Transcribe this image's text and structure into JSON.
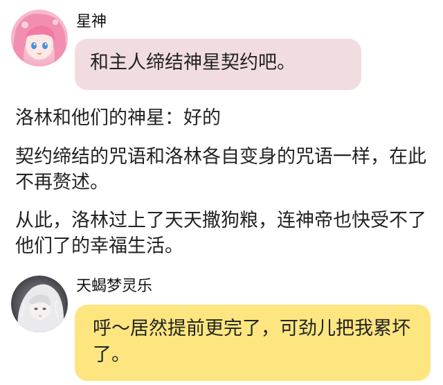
{
  "messages": [
    {
      "sender": "星神",
      "avatar_icon": "pink-hair-anime-girl-avatar-icon",
      "text": "和主人缔结神星契约吧。",
      "bubble_color": "#f1dde0"
    },
    {
      "sender": "天蝎梦灵乐",
      "avatar_icon": "white-hair-character-avatar-icon",
      "text": "呼～居然提前更完了，可劲儿把我累坏了。",
      "bubble_color": "#fde680"
    }
  ],
  "narration": [
    "洛林和他们的神星：好的",
    "契约缔结的咒语和洛林各自变身的咒语一样，在此不再赘述。",
    "从此，洛林过上了天天撒狗粮，连神帝也快受不了他们了的幸福生活。"
  ]
}
